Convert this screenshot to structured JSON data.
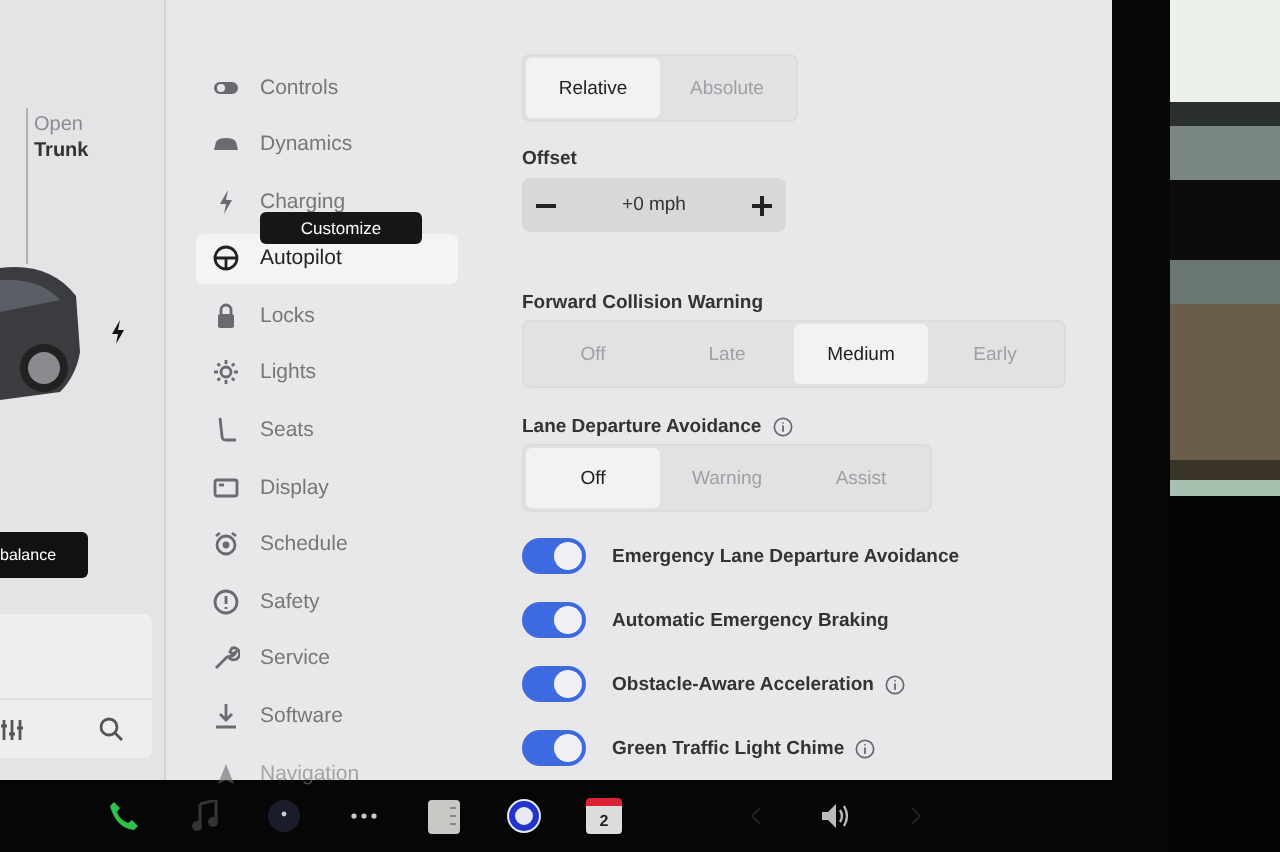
{
  "left_panel": {
    "trunk": {
      "line1": "Open",
      "line2": "Trunk"
    },
    "tooltip": "balance"
  },
  "menu": {
    "tooltip": "Customize",
    "items": [
      {
        "label": "Controls",
        "selected": false
      },
      {
        "label": "Dynamics",
        "selected": false
      },
      {
        "label": "Charging",
        "selected": false
      },
      {
        "label": "Autopilot",
        "selected": true
      },
      {
        "label": "Locks",
        "selected": false
      },
      {
        "label": "Lights",
        "selected": false
      },
      {
        "label": "Seats",
        "selected": false
      },
      {
        "label": "Display",
        "selected": false
      },
      {
        "label": "Schedule",
        "selected": false
      },
      {
        "label": "Safety",
        "selected": false
      },
      {
        "label": "Service",
        "selected": false
      },
      {
        "label": "Software",
        "selected": false
      },
      {
        "label": "Navigation",
        "selected": false
      }
    ]
  },
  "speed_mode": {
    "options": [
      {
        "label": "Relative",
        "selected": true
      },
      {
        "label": "Absolute",
        "selected": false
      }
    ]
  },
  "offset": {
    "label": "Offset",
    "value": "+0 mph"
  },
  "forward_collision_warning": {
    "label": "Forward Collision Warning",
    "options": [
      {
        "label": "Off",
        "selected": false
      },
      {
        "label": "Late",
        "selected": false
      },
      {
        "label": "Medium",
        "selected": true
      },
      {
        "label": "Early",
        "selected": false
      }
    ]
  },
  "lane_departure_avoidance": {
    "label": "Lane Departure Avoidance",
    "options": [
      {
        "label": "Off",
        "selected": true
      },
      {
        "label": "Warning",
        "selected": false
      },
      {
        "label": "Assist",
        "selected": false
      }
    ]
  },
  "toggles": [
    {
      "label": "Emergency Lane Departure Avoidance",
      "on": true,
      "info": false
    },
    {
      "label": "Automatic Emergency Braking",
      "on": true,
      "info": false
    },
    {
      "label": "Obstacle-Aware Acceleration",
      "on": true,
      "info": true
    },
    {
      "label": "Green Traffic Light Chime",
      "on": true,
      "info": true
    }
  ],
  "dock": {
    "calendar_day": "2"
  }
}
